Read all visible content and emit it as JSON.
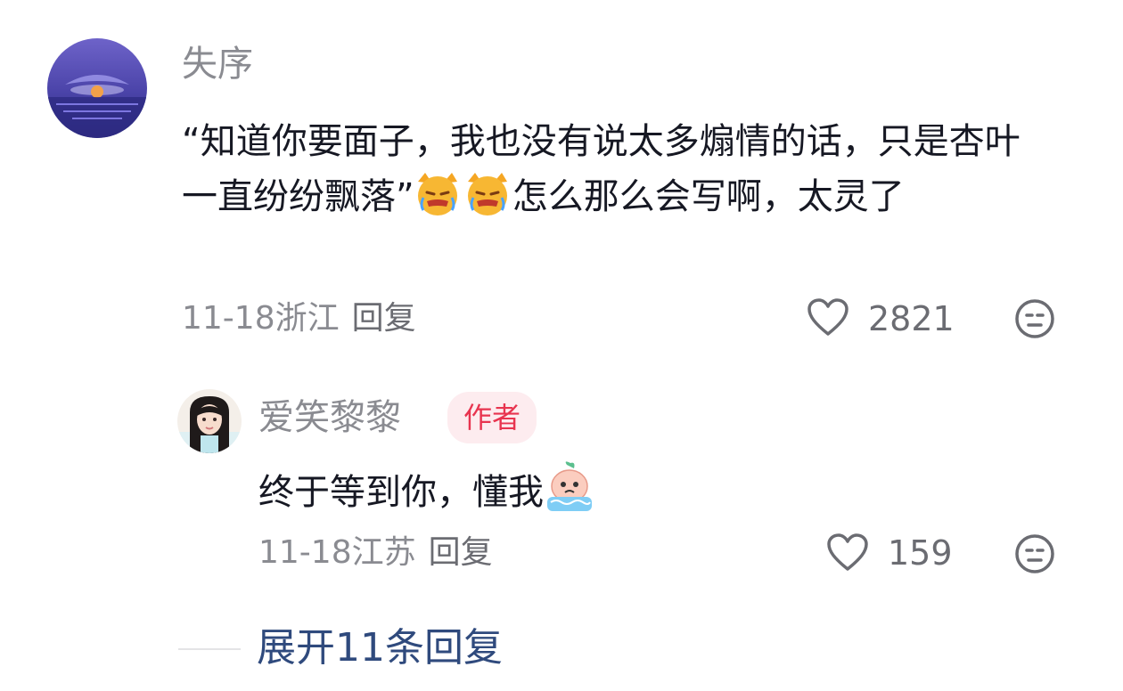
{
  "comments": [
    {
      "username": "失序",
      "text_part1": "“知道你要面子，我也没有说太多煽情的话，只是杏叶一直纷纷飘落”",
      "emoji": "crying-cat-emoji",
      "text_part2": "怎么那么会写啊，太灵了",
      "date": "11-18",
      "location": "浙江",
      "reply_label": "回复",
      "like_count": "2821"
    }
  ],
  "reply": {
    "username": "爱笑黎黎",
    "badge": "作者",
    "text": "终于等到你，懂我",
    "emoji": "crying-peach-emoji",
    "date": "11-18",
    "location": "江苏",
    "reply_label": "回复",
    "like_count": "159"
  },
  "expand": {
    "label": "展开11条回复"
  },
  "colors": {
    "text": "#161823",
    "muted": "#8a8b91",
    "badge_bg": "#fdecef",
    "badge_text": "#e8344f",
    "link": "#2f4a7d"
  },
  "icons": {
    "like": "heart-outline-icon",
    "dislike": "neutral-face-icon"
  }
}
